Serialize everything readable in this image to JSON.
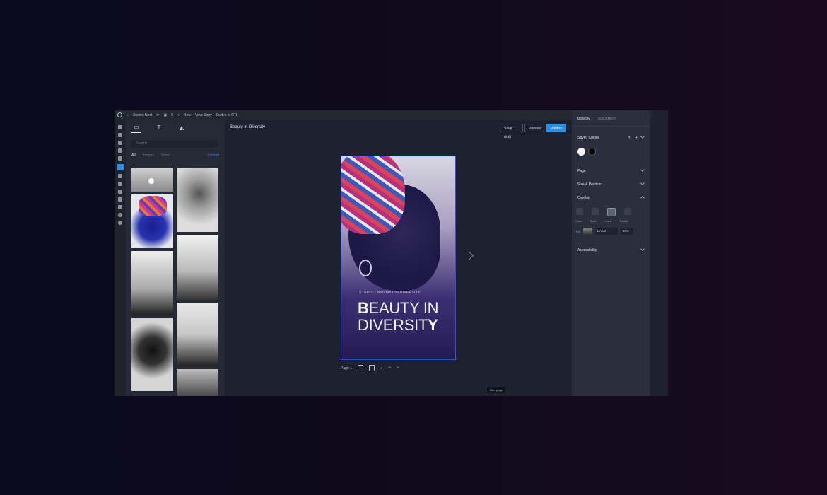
{
  "adminbar": {
    "site_name": "Stories Next",
    "comments_count": "0",
    "new_label": "New",
    "view_story_label": "View Story",
    "switch_label": "Switch to RTL"
  },
  "library": {
    "search_placeholder": "Search",
    "filters": [
      "All",
      "Images",
      "Video"
    ],
    "upload_label": "Upload"
  },
  "canvas": {
    "document_title": "Beauty In Diversity",
    "save_draft_label": "Save draft",
    "preview_label": "Preview",
    "publish_label": "Publish",
    "story_kicker": "STUDIO - Naturalle IN DIVERSITY",
    "story_heading_b": "B",
    "story_heading_rest1": "EAUTY IN",
    "story_heading_line2": "DIVERSIT",
    "story_heading_y": "Y",
    "page_label": "Page 1",
    "tooltip": "New page"
  },
  "panel": {
    "tab_design": "DESIGN",
    "tab_document": "DOCUMENT",
    "saved_colors": "Saved Colors",
    "swatch_colors": [
      "#ffffff",
      "#000000"
    ],
    "sections": [
      "Page",
      "Size & Position",
      "Overlay",
      "Accessibility"
    ],
    "overlay_options": [
      "None",
      "Solid",
      "Linear",
      "Radial"
    ],
    "fill_label": "Fill",
    "fill_type": "Linear",
    "fill_percent": "90%"
  }
}
